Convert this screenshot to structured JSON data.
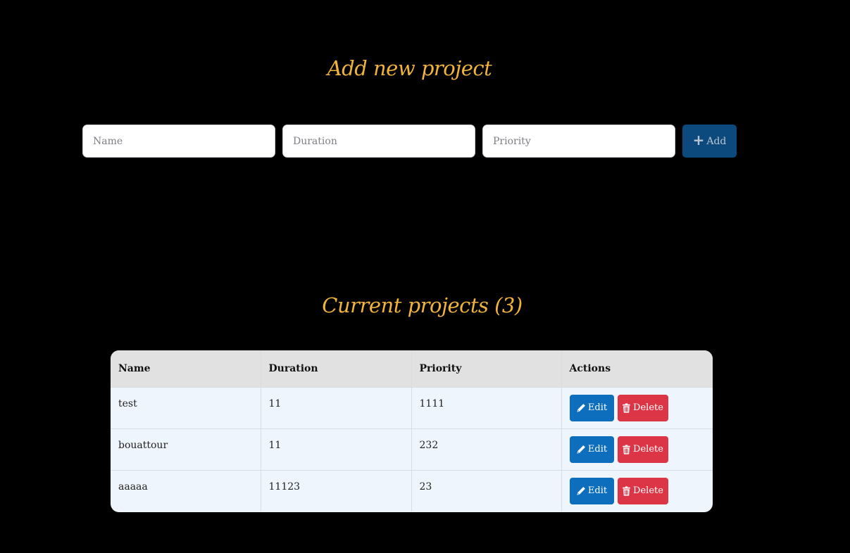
{
  "add_section": {
    "title": "Add new project",
    "name_placeholder": "Name",
    "duration_placeholder": "Duration",
    "priority_placeholder": "Priority",
    "add_label": "Add",
    "add_icon": "plus-icon"
  },
  "current_section": {
    "title": "Current projects (3)"
  },
  "table": {
    "headers": [
      "Name",
      "Duration",
      "Priority",
      "Actions"
    ],
    "rows": [
      {
        "name": "test",
        "duration": "11",
        "priority": "1111"
      },
      {
        "name": "bouattour",
        "duration": "11",
        "priority": "232"
      },
      {
        "name": "aaaaa",
        "duration": "11123",
        "priority": "23"
      }
    ],
    "edit_label": "Edit",
    "delete_label": "Delete",
    "edit_icon": "pencil-icon",
    "delete_icon": "trash-icon"
  },
  "colors": {
    "background": "#000000",
    "heading": "#f0b43c",
    "add_button": "#0c4a7e",
    "edit_button": "#0d6ebd",
    "delete_button": "#dc3545",
    "table_header": "#e1e1e2",
    "table_body": "#eef5fc"
  }
}
